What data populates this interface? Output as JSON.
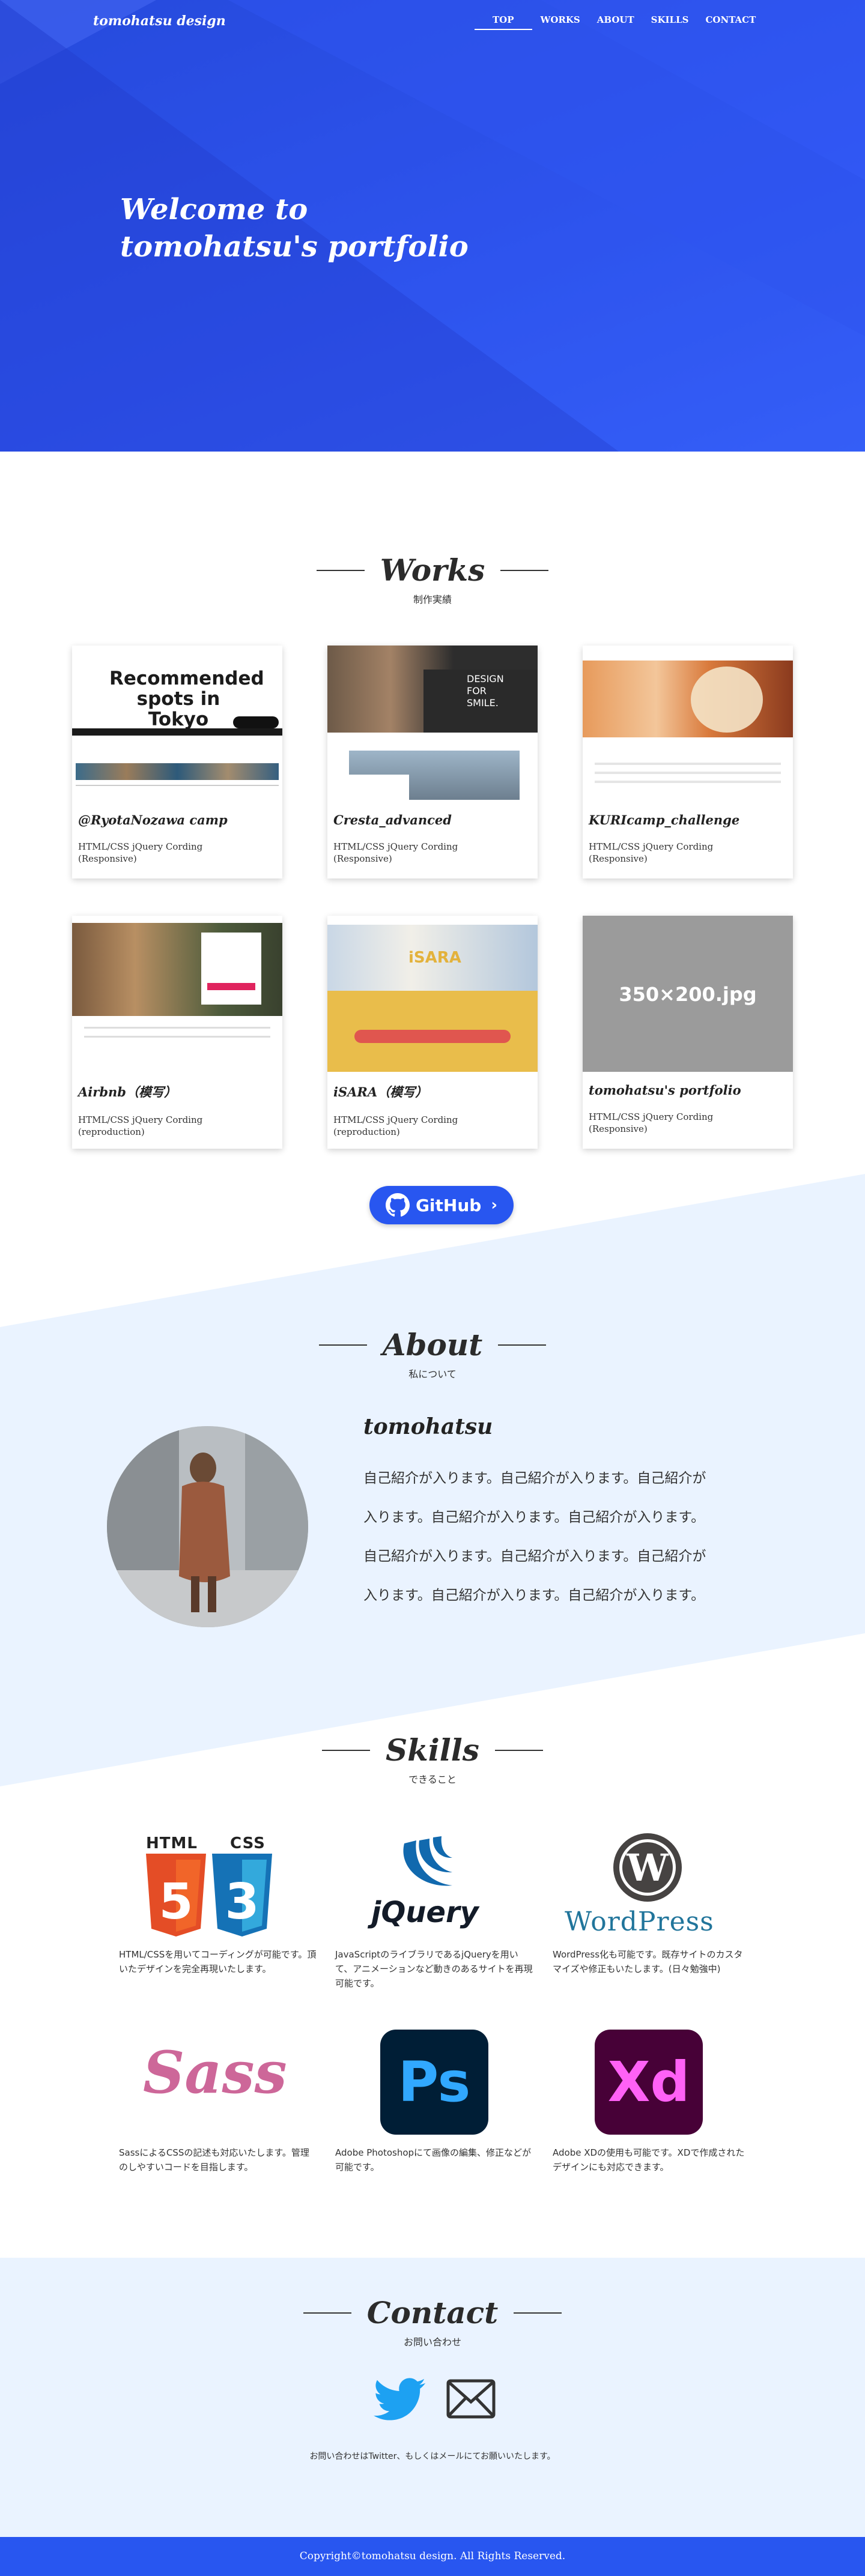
{
  "header": {
    "logo": "tomohatsu design",
    "nav": [
      "TOP",
      "WORKS",
      "ABOUT",
      "SKILLS",
      "CONTACT"
    ]
  },
  "hero": {
    "line1": "Welcome to",
    "line2": "tomohatsu's portfolio"
  },
  "works": {
    "title": "Works",
    "subtitle": "制作実績",
    "items": [
      {
        "title": "@RyotaNozawa camp",
        "desc1": "HTML/CSS  jQuery Cording",
        "desc2": "(Responsive)",
        "thumb_text": "Recommended spots in Tokyo"
      },
      {
        "title": "Cresta_advanced",
        "desc1": "HTML/CSS  jQuery Cording",
        "desc2": "(Responsive)",
        "thumb_text": "DESIGN FOR SMILE."
      },
      {
        "title": "KURIcamp_challenge",
        "desc1": "HTML/CSS  jQuery Cording",
        "desc2": "(Responsive)",
        "thumb_text": ""
      },
      {
        "title": "Airbnb（模写）",
        "desc1": "HTML/CSS  jQuery Cording",
        "desc2": "(reproduction)",
        "thumb_text": ""
      },
      {
        "title": "iSARA（模写）",
        "desc1": "HTML/CSS  jQuery Cording",
        "desc2": "(reproduction)",
        "thumb_text": "iSARA"
      },
      {
        "title": "tomohatsu's portfolio",
        "desc1": "HTML/CSS  jQuery Cording",
        "desc2": "(Responsive)",
        "thumb_text": "350×200.jpg"
      }
    ],
    "github_label": "GitHub"
  },
  "about": {
    "title": "About",
    "subtitle": "私について",
    "name": "tomohatsu",
    "text": "自己紹介が入ります。自己紹介が入ります。自己紹介が入ります。自己紹介が入ります。自己紹介が入ります。自己紹介が入ります。自己紹介が入ります。自己紹介が入ります。自己紹介が入ります。自己紹介が入ります。"
  },
  "skills": {
    "title": "Skills",
    "subtitle": "できること",
    "items": [
      {
        "icon": "html5-css3-icon",
        "text": "HTML/CSSを用いてコーディングが可能です。頂いたデザインを完全再現いたします。"
      },
      {
        "icon": "jquery-icon",
        "text": "JavaScriptのライブラリであるjQueryを用いて、アニメーションなど動きのあるサイトを再現可能です。"
      },
      {
        "icon": "wordpress-icon",
        "text": "WordPress化も可能です。既存サイトのカスタマイズや修正もいたします。(日々勉強中)"
      },
      {
        "icon": "sass-icon",
        "text": "SassによるCSSの記述も対応いたします。管理のしやすいコードを目指します。"
      },
      {
        "icon": "photoshop-icon",
        "text": "Adobe Photoshopにて画像の編集、修正などが可能です。"
      },
      {
        "icon": "adobe-xd-icon",
        "text": "Adobe XDの使用も可能です。XDで作成されたデザインにも対応できます。"
      }
    ],
    "logo_text": {
      "html": "HTML",
      "css": "CSS",
      "jquery": "jQuery",
      "wordpress": "WordPress",
      "sass": "Sass",
      "ps": "Ps",
      "xd": "Xd"
    }
  },
  "contact": {
    "title": "Contact",
    "subtitle": "お問い合わせ",
    "text": "お問い合わせはTwitter、もしくはメールにてお願いいたします。"
  },
  "footer": {
    "copyright": "Copyright©tomohatsu design. All Rights Reserved."
  },
  "colors": {
    "brand": "#2856f0",
    "light_bg": "#eaf3ff"
  }
}
